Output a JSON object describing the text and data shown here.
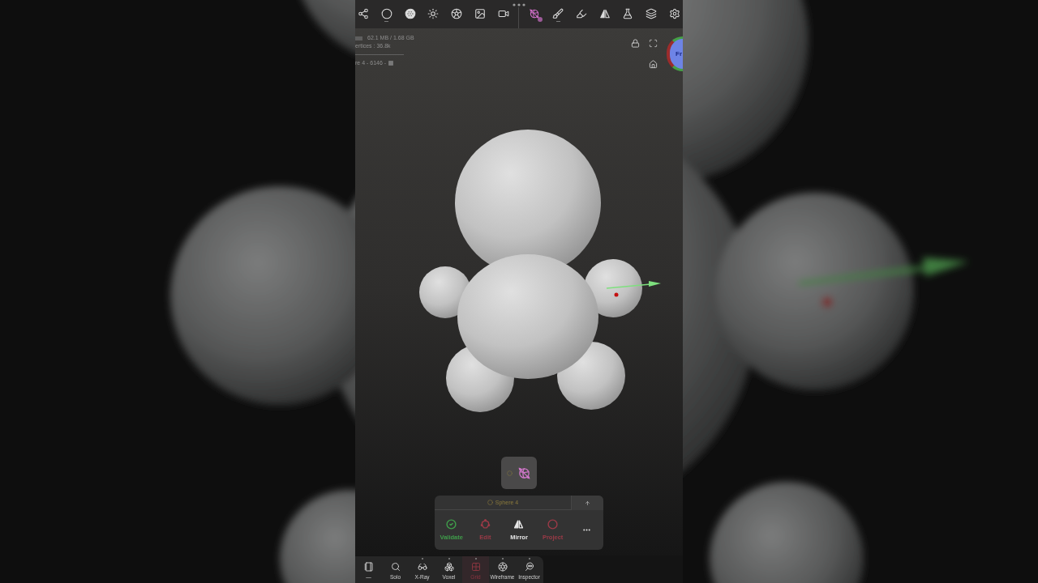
{
  "top_toolbar": {
    "tools": [
      {
        "selected": false,
        "submenu": false
      },
      {
        "selected": false,
        "submenu": true
      },
      {
        "selected": false,
        "submenu": false
      },
      {
        "selected": false,
        "submenu": false
      },
      {
        "selected": false,
        "submenu": false
      },
      {
        "selected": false,
        "submenu": false
      },
      {
        "selected": false,
        "submenu": false
      },
      {
        "selected": true,
        "submenu": false
      },
      {
        "selected": false,
        "submenu": true
      },
      {
        "selected": false,
        "submenu": false
      },
      {
        "selected": false,
        "submenu": false
      },
      {
        "selected": false,
        "submenu": false
      },
      {
        "selected": false,
        "submenu": false
      },
      {
        "selected": false,
        "submenu": false
      }
    ]
  },
  "viewport": {
    "stats": {
      "memory": "62.1 MB / 1.68 GB",
      "vertices": "ertices : 36.8k",
      "selection": "re 4 - 6146 -"
    },
    "view_cube": {
      "face": "Fr"
    }
  },
  "tool_popup": {
    "object_name": "Sphere 4",
    "actions": [
      {
        "label": "Validate",
        "color": "#3f9d4a"
      },
      {
        "label": "Edit",
        "color": "#9b3a47"
      },
      {
        "label": "Mirror",
        "color": "#e6e6e6"
      },
      {
        "label": "Project",
        "color": "#9b3a47"
      }
    ]
  },
  "bottom_toolbar": {
    "items": [
      {
        "label": "—",
        "selected": false,
        "indicator": false
      },
      {
        "label": "Solo",
        "selected": false,
        "indicator": false
      },
      {
        "label": "X-Ray",
        "selected": false,
        "indicator": true
      },
      {
        "label": "Voxel",
        "selected": false,
        "indicator": true
      },
      {
        "label": "Grid",
        "selected": true,
        "indicator": true
      },
      {
        "label": "Wireframe",
        "selected": false,
        "indicator": true
      },
      {
        "label": "Inspector",
        "selected": false,
        "indicator": true
      }
    ]
  }
}
